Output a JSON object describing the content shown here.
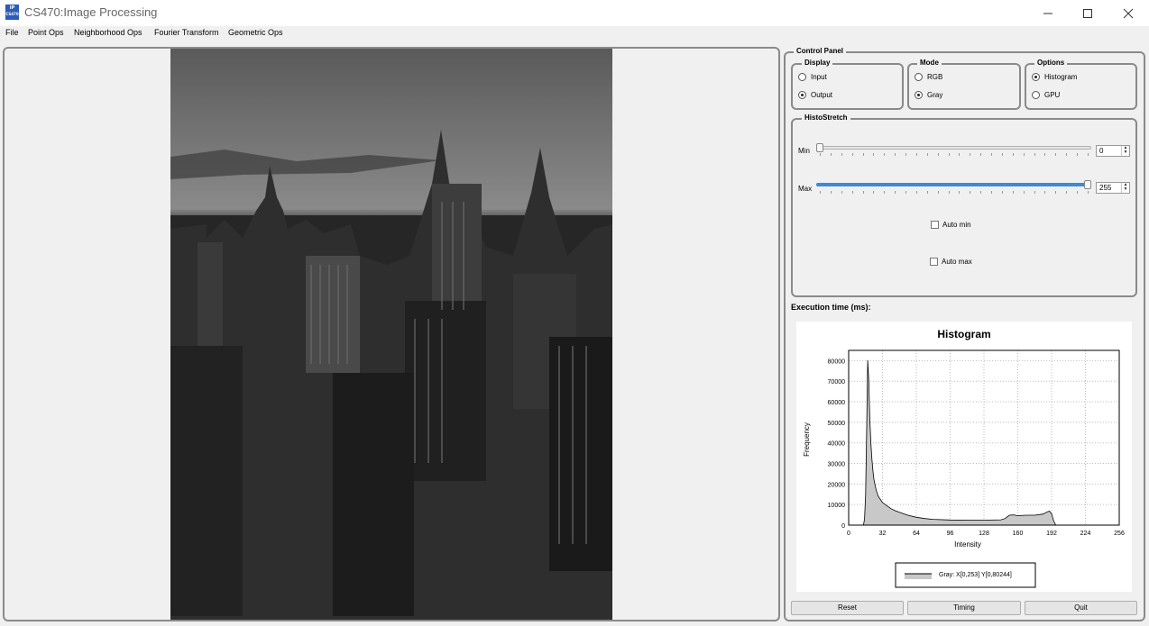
{
  "window": {
    "title": "CS470:Image Processing",
    "icon_text_top": "IP",
    "icon_text_bottom": "CS470",
    "controls": [
      "minimize-icon",
      "maximize-icon",
      "close-icon"
    ]
  },
  "menu": [
    "File",
    "Point Ops",
    "Neighborhood Ops",
    "Fourier Transform",
    "Geometric Ops"
  ],
  "control_panel": {
    "title": "Control Panel",
    "display": {
      "title": "Display",
      "options": [
        {
          "label": "Input",
          "selected": false
        },
        {
          "label": "Output",
          "selected": true
        }
      ]
    },
    "mode": {
      "title": "Mode",
      "options": [
        {
          "label": "RGB",
          "selected": false
        },
        {
          "label": "Gray",
          "selected": true
        }
      ]
    },
    "options": {
      "title": "Options",
      "options": [
        {
          "label": "Histogram",
          "selected": true
        },
        {
          "label": "GPU",
          "selected": false
        }
      ]
    },
    "histostretch": {
      "title": "HistoStretch",
      "min_label": "Min",
      "min_value": "0",
      "max_label": "Max",
      "max_value": "255",
      "min_fraction": 0.0,
      "max_fraction": 1.0,
      "auto_min_label": "Auto min",
      "auto_max_label": "Auto max"
    }
  },
  "execution_label": "Execution time (ms):",
  "buttons": {
    "reset": "Reset",
    "timing": "Timing",
    "quit": "Quit"
  },
  "chart_data": {
    "type": "area",
    "title": "Histogram",
    "xlabel": "Intensity",
    "ylabel": "Frequency",
    "xlim": [
      0,
      256
    ],
    "ylim": [
      0,
      85000
    ],
    "x_ticks": [
      0,
      32,
      64,
      96,
      128,
      160,
      192,
      224,
      256
    ],
    "y_ticks": [
      0,
      10000,
      20000,
      30000,
      40000,
      50000,
      60000,
      70000,
      80000
    ],
    "grid": true,
    "legend_position": "bottom-center",
    "series": [
      {
        "name": "Gray: X[0,253] Y[0,80244]",
        "color": "#c8c8c8",
        "line_color": "#000000",
        "x": [
          0,
          14,
          15,
          16,
          17,
          18,
          19,
          20,
          21,
          22,
          23,
          24,
          26,
          28,
          30,
          32,
          36,
          40,
          44,
          48,
          56,
          64,
          72,
          80,
          96,
          112,
          128,
          144,
          148,
          152,
          156,
          160,
          168,
          176,
          184,
          188,
          190,
          192,
          194,
          196,
          200,
          256
        ],
        "y": [
          0,
          0,
          3000,
          15000,
          45000,
          80244,
          70000,
          52000,
          40000,
          32000,
          26000,
          22000,
          17000,
          14000,
          12500,
          11000,
          9500,
          8000,
          7000,
          6200,
          4800,
          3800,
          3200,
          2800,
          2500,
          2400,
          2400,
          2600,
          3200,
          4800,
          5000,
          4600,
          4800,
          4800,
          5400,
          6500,
          6800,
          5500,
          2000,
          0,
          0,
          0
        ]
      }
    ]
  }
}
